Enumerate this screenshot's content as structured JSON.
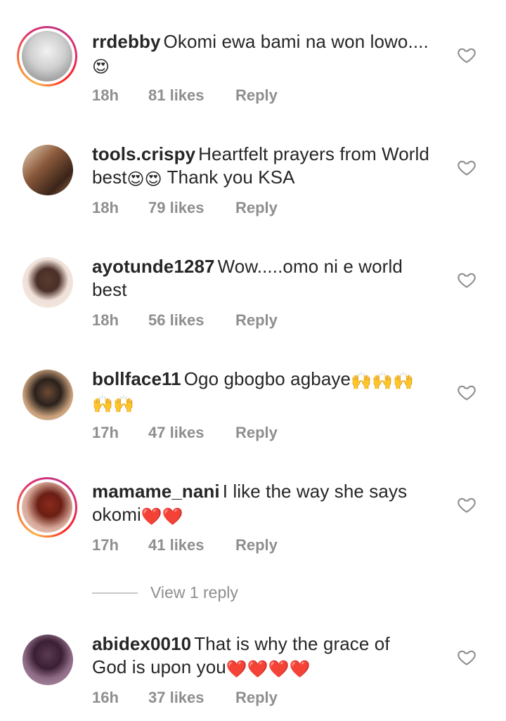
{
  "comments": [
    {
      "username": "rrdebby",
      "text": "Okomi ewa bami na won lowo....",
      "emoji": "😍",
      "time": "18h",
      "likes": "81 likes",
      "reply": "Reply",
      "avatar_colors": [
        "#d9d9d9",
        "#8a8a8a"
      ],
      "story_ring": true
    },
    {
      "username": "tools.crispy",
      "text": "Heartfelt prayers from World best",
      "emoji": "😍😍",
      "text_after": " Thank you KSA",
      "time": "18h",
      "likes": "79 likes",
      "reply": "Reply",
      "avatar_colors": [
        "#8b5a3c",
        "#3a2418"
      ],
      "story_ring": false
    },
    {
      "username": "ayotunde1287",
      "text": "Wow.....omo ni e world best",
      "time": "18h",
      "likes": "56 likes",
      "reply": "Reply",
      "avatar_colors": [
        "#f3e8e2",
        "#4a2f28"
      ],
      "story_ring": false
    },
    {
      "username": "bollface11",
      "text": "Ogo gbogbo agbaye",
      "emoji": "🙌🙌🙌🙌🙌",
      "time": "17h",
      "likes": "47 likes",
      "reply": "Reply",
      "avatar_colors": [
        "#c9a07a",
        "#1f1a17"
      ],
      "story_ring": false
    },
    {
      "username": "mamame_nani",
      "text": "I like the way she says okomi",
      "emoji": "❤️❤️",
      "time": "17h",
      "likes": "41 likes",
      "reply": "Reply",
      "avatar_colors": [
        "#e6d0c4",
        "#6b1e14"
      ],
      "story_ring": true
    },
    {
      "username": "abidex0010",
      "text": "That is why the grace of God is upon you",
      "emoji": "❤️❤️❤️❤️",
      "time": "16h",
      "likes": "37 likes",
      "reply": "Reply",
      "avatar_colors": [
        "#3a1f33",
        "#8d6a85"
      ],
      "story_ring": false
    }
  ],
  "view_replies": "View 1 reply",
  "colors": {
    "muted": "#8e8e8e",
    "text": "#262626",
    "heart_outline": "#8e8e8e"
  }
}
